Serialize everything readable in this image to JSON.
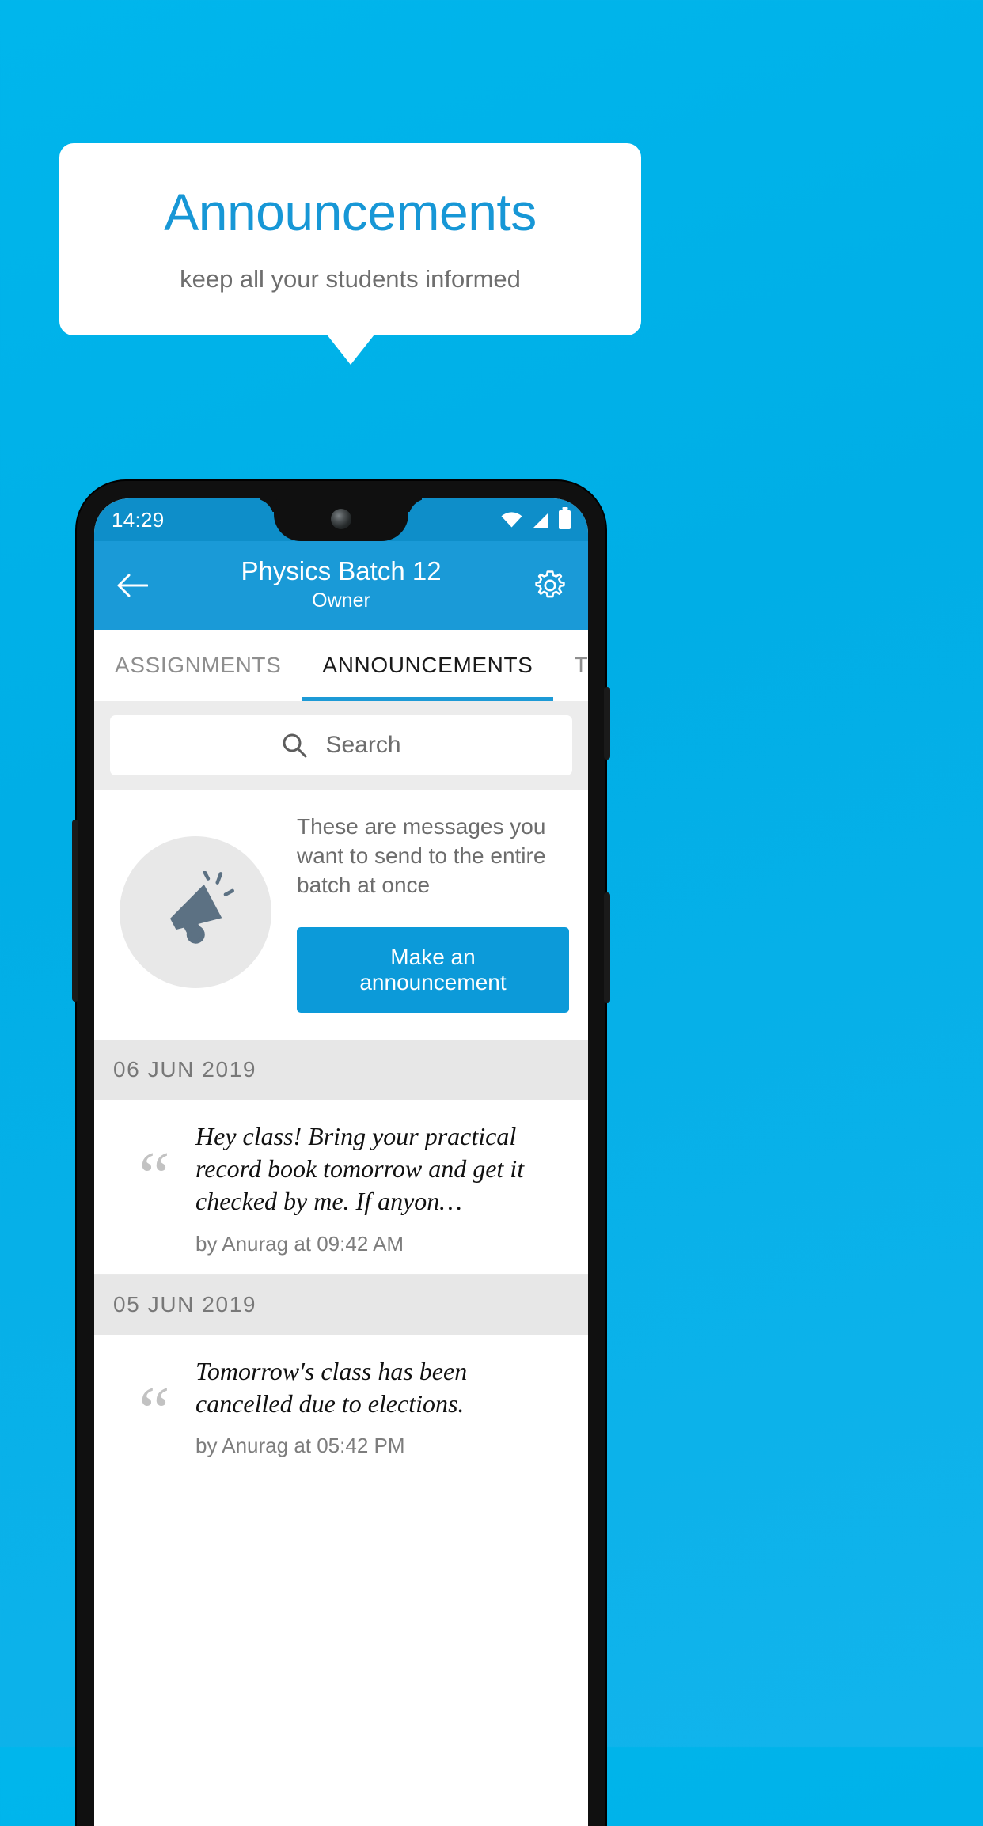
{
  "promo": {
    "title": "Announcements",
    "subtitle": "keep all your students informed",
    "title_color": "#1797d6",
    "background_color": "#00b0e8"
  },
  "phone": {
    "statusbar": {
      "time": "14:29",
      "icons": [
        "wifi-icon",
        "signal-icon",
        "battery-icon"
      ]
    },
    "appbar": {
      "back_icon": "arrow-left-icon",
      "title": "Physics Batch 12",
      "subtitle": "Owner",
      "settings_icon": "gear-icon",
      "background_color": "#1a9ad7"
    },
    "tabs": [
      {
        "label": "ASSIGNMENTS",
        "active": false
      },
      {
        "label": "ANNOUNCEMENTS",
        "active": true
      },
      {
        "label": "TESTS",
        "active": false
      },
      {
        "label": "'",
        "active": false
      }
    ],
    "search": {
      "icon": "search-icon",
      "placeholder": "Search",
      "value": ""
    },
    "banner": {
      "icon": "megaphone-icon",
      "text": "These are messages you want to send to the entire batch at once",
      "cta_label": "Make an announcement",
      "cta_color": "#0c9ad9"
    },
    "groups": [
      {
        "date": "06  JUN  2019",
        "items": [
          {
            "quote_icon": "quote-icon",
            "text": "Hey class! Bring your practical record book tomorrow and get it checked by me. If anyon…",
            "meta": "by Anurag at 09:42 AM"
          }
        ]
      },
      {
        "date": "05  JUN  2019",
        "items": [
          {
            "quote_icon": "quote-icon",
            "text": "Tomorrow's class has been cancelled due to elections.",
            "meta": "by Anurag at 05:42 PM"
          }
        ]
      }
    ]
  }
}
